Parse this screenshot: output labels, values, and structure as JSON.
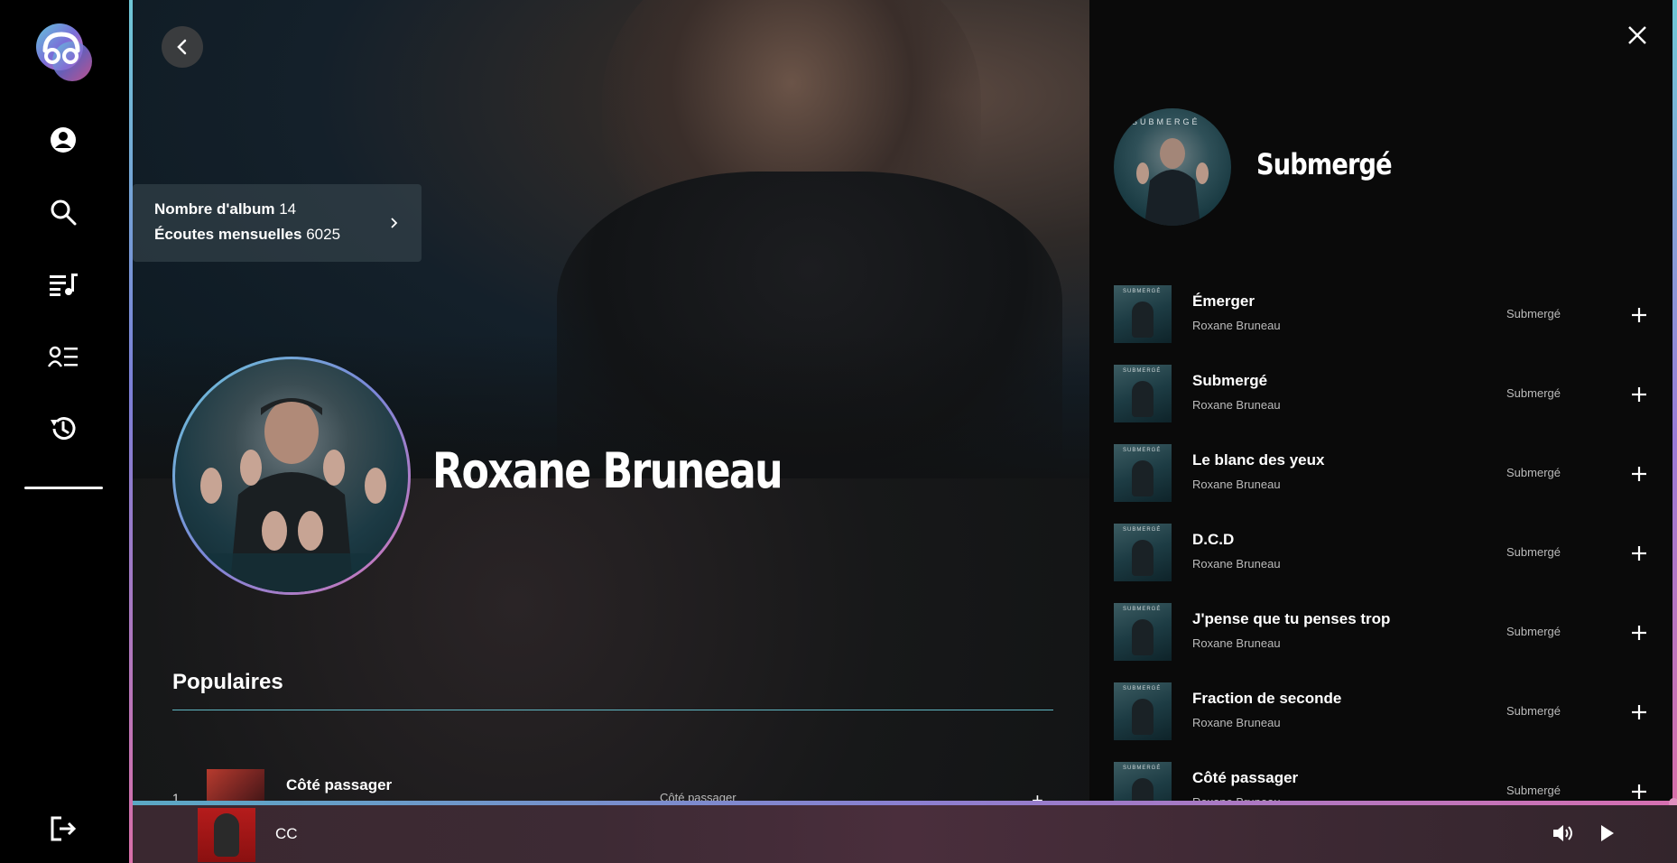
{
  "sidebar": {
    "nav": [
      {
        "name": "profile-icon"
      },
      {
        "name": "search-icon"
      },
      {
        "name": "playlist-icon"
      },
      {
        "name": "artists-list-icon"
      },
      {
        "name": "history-icon"
      }
    ],
    "logout_icon": "logout-icon"
  },
  "artist": {
    "name": "Roxane Bruneau",
    "stats": {
      "albums_label": "Nombre d'album",
      "albums_value": "14",
      "listeners_label": "Écoutes mensuelles",
      "listeners_value": "6025"
    },
    "popular_title": "Populaires",
    "popular": [
      {
        "rank": "1",
        "title": "Côté passager",
        "album": "Côté passager"
      }
    ]
  },
  "album_panel": {
    "title": "Submergé",
    "cover_text": "SUBMERGÉ",
    "tracks": [
      {
        "title": "Émerger",
        "artist": "Roxane Bruneau",
        "album": "Submergé"
      },
      {
        "title": "Submergé",
        "artist": "Roxane Bruneau",
        "album": "Submergé"
      },
      {
        "title": "Le blanc des yeux",
        "artist": "Roxane Bruneau",
        "album": "Submergé"
      },
      {
        "title": "D.C.D",
        "artist": "Roxane Bruneau",
        "album": "Submergé"
      },
      {
        "title": "J'pense que tu penses trop",
        "artist": "Roxane Bruneau",
        "album": "Submergé"
      },
      {
        "title": "Fraction de seconde",
        "artist": "Roxane Bruneau",
        "album": "Submergé"
      },
      {
        "title": "Côté passager",
        "artist": "Roxane Bruneau",
        "album": "Submergé"
      }
    ]
  },
  "player": {
    "title": "CC",
    "progress": 1.0
  },
  "colors": {
    "accent_gradient_start": "#6fc7d6",
    "accent_gradient_end": "#d96fa8",
    "section_rule": "#5fb7c3"
  }
}
